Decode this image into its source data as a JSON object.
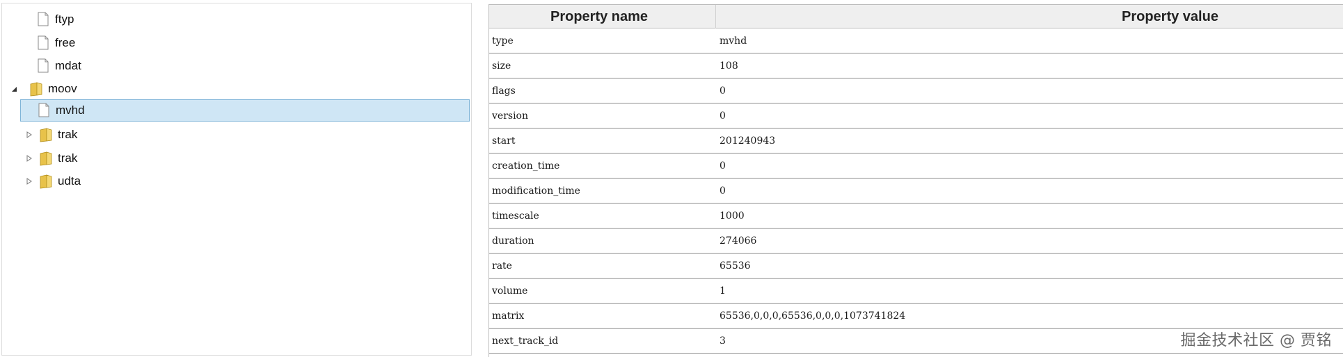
{
  "tree": {
    "items": [
      {
        "label": "ftyp",
        "type": "file",
        "expander": "none"
      },
      {
        "label": "free",
        "type": "file",
        "expander": "none"
      },
      {
        "label": "mdat",
        "type": "file",
        "expander": "none"
      },
      {
        "label": "moov",
        "type": "folder",
        "expander": "expanded"
      },
      {
        "label": "mvhd",
        "type": "file",
        "expander": "none",
        "selected": true
      },
      {
        "label": "trak",
        "type": "folder",
        "expander": "collapsed"
      },
      {
        "label": "trak",
        "type": "folder",
        "expander": "collapsed"
      },
      {
        "label": "udta",
        "type": "folder",
        "expander": "collapsed"
      }
    ]
  },
  "grid": {
    "header": {
      "name": "Property name",
      "value": "Property value"
    },
    "rows": [
      {
        "name": "type",
        "value": "mvhd"
      },
      {
        "name": "size",
        "value": "108"
      },
      {
        "name": "flags",
        "value": "0"
      },
      {
        "name": "version",
        "value": "0"
      },
      {
        "name": "start",
        "value": "201240943"
      },
      {
        "name": "creation_time",
        "value": "0"
      },
      {
        "name": "modification_time",
        "value": "0"
      },
      {
        "name": "timescale",
        "value": "1000"
      },
      {
        "name": "duration",
        "value": "274066"
      },
      {
        "name": "rate",
        "value": "65536"
      },
      {
        "name": "volume",
        "value": "1"
      },
      {
        "name": "matrix",
        "value": "65536,0,0,0,65536,0,0,0,1073741824"
      },
      {
        "name": "next_track_id",
        "value": "3"
      }
    ]
  },
  "watermark": "掘金技术社区 @ 贾铭",
  "colors": {
    "selection_bg": "#cfe6f5",
    "selection_border": "#7fb4d8",
    "folder_yellow": "#e8c24a",
    "row_border": "#8e8e8e"
  },
  "icons": {
    "file": "file-icon",
    "folder": "folder-icon",
    "expanded": "expanded-triangle-icon",
    "collapsed": "collapsed-triangle-icon"
  }
}
